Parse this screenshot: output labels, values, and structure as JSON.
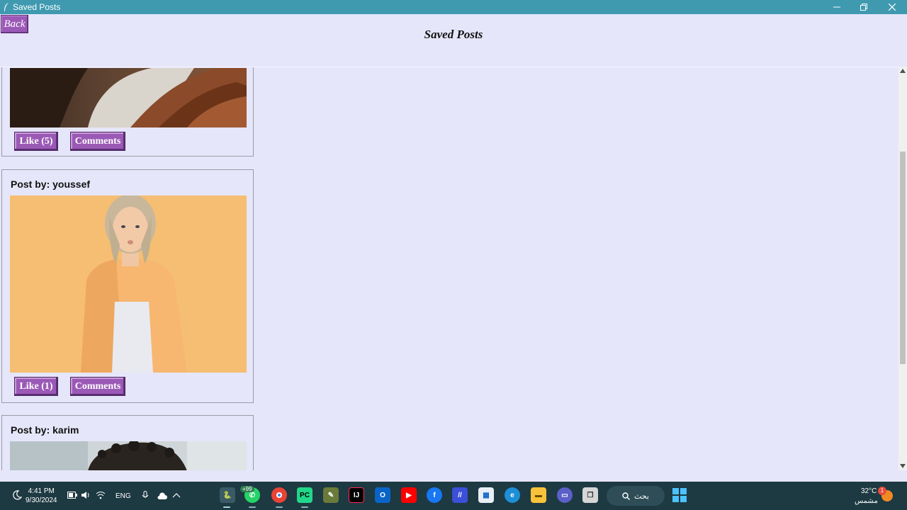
{
  "window": {
    "title": "Saved Posts"
  },
  "header": {
    "back_label": "Back",
    "page_title": "Saved Posts"
  },
  "posts": [
    {
      "author": "",
      "like_label": "Like (5)",
      "comments_label": "Comments"
    },
    {
      "author": "Post by: youssef",
      "like_label": "Like (1)",
      "comments_label": "Comments"
    },
    {
      "author": "Post by: karim",
      "like_label": "",
      "comments_label": ""
    }
  ],
  "taskbar": {
    "time": "4:41 PM",
    "date": "9/30/2024",
    "language": "ENG",
    "whatsapp_badge": "+99",
    "search_label": "بحث",
    "weather_temp": "32°C",
    "weather_label": "مشمس",
    "notification_count": "1"
  },
  "colors": {
    "accent": "#9b59b6",
    "background": "#e6e6fa",
    "titlebar": "#3f9ab0",
    "taskbar": "#1d3942"
  }
}
